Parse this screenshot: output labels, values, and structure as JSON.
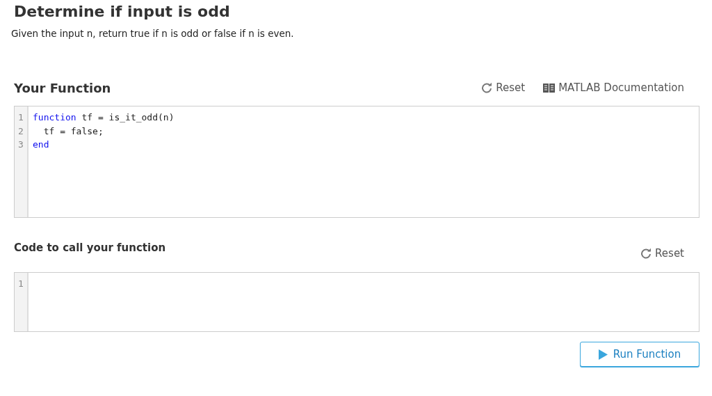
{
  "title": "Determine if input is odd",
  "description": "Given the input n, return true if n is odd or false if n is even.",
  "function_section": {
    "heading": "Your Function",
    "reset": "Reset",
    "docs": "MATLAB Documentation",
    "lines": [
      {
        "number": "1",
        "tokens": [
          {
            "kind": "keyword",
            "text": "function"
          },
          {
            "kind": "plain",
            "text": " tf = is_it_odd(n)"
          }
        ]
      },
      {
        "number": "2",
        "tokens": [
          {
            "kind": "plain",
            "text": "  tf = false;"
          }
        ]
      },
      {
        "number": "3",
        "tokens": [
          {
            "kind": "keyword",
            "text": "end"
          }
        ]
      }
    ]
  },
  "call_section": {
    "heading": "Code to call your function",
    "reset": "Reset",
    "lines": [
      {
        "number": "1"
      }
    ]
  },
  "run_button": "Run Function"
}
